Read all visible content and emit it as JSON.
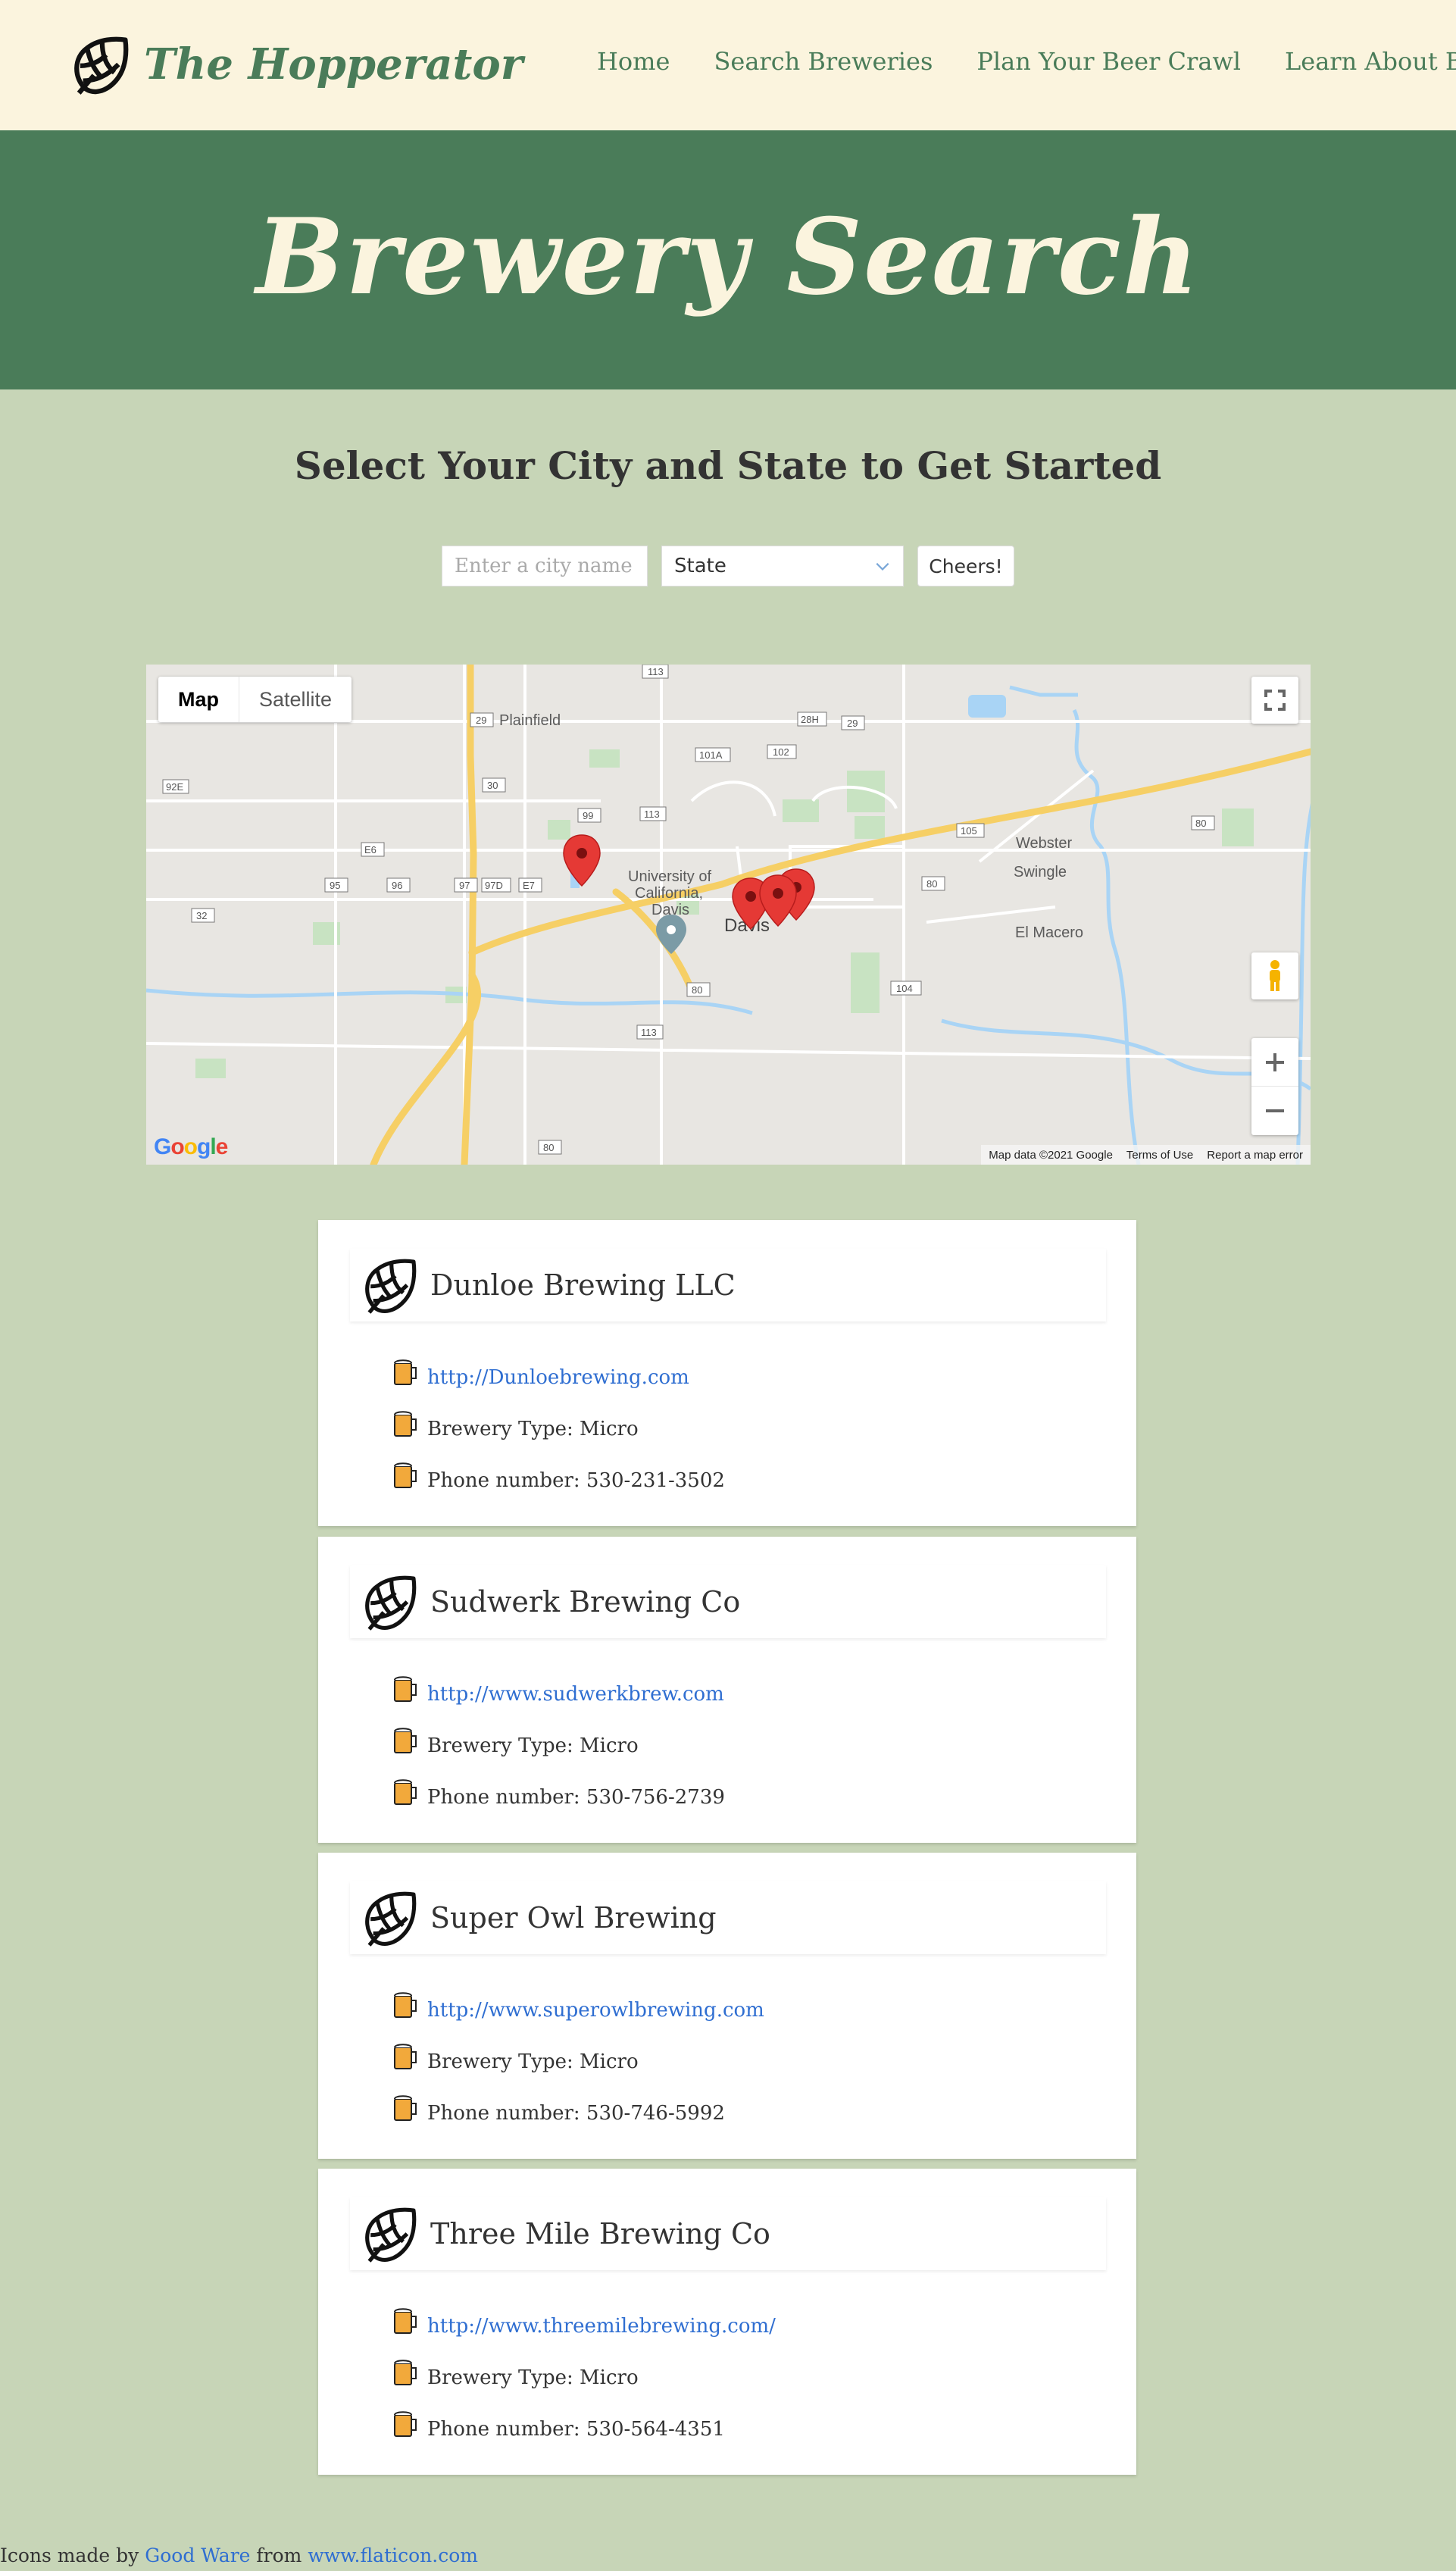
{
  "nav": {
    "brand": "The Hopperator",
    "links": [
      "Home",
      "Search Breweries",
      "Plan Your Beer Crawl",
      "Learn About Beer"
    ]
  },
  "hero": {
    "title": "Brewery Search"
  },
  "search": {
    "heading": "Select Your City and State to Get Started",
    "city_placeholder": "Enter a city name",
    "city_value": "",
    "state_selected": "State",
    "submit_label": "Cheers!"
  },
  "map": {
    "type_map": "Map",
    "type_satellite": "Satellite",
    "labels": {
      "plainfield": "Plainfield",
      "university": "University of",
      "university2": "California,",
      "university3": "Davis",
      "davis": "Davis",
      "el_macero": "El Macero",
      "swingle": "Swingle",
      "webster": "Webster"
    },
    "road_shields": [
      "113",
      "29",
      "28H",
      "29",
      "101A",
      "102",
      "92E",
      "30",
      "99",
      "113",
      "105",
      "E6",
      "95",
      "96",
      "97",
      "97D",
      "E7",
      "32",
      "80",
      "80",
      "104",
      "113",
      "80",
      "80"
    ],
    "logo": "Google",
    "footer": [
      "Map data ©2021 Google",
      "Terms of Use",
      "Report a map error"
    ]
  },
  "breweries": [
    {
      "name": "Dunloe Brewing LLC",
      "url": "http://Dunloebrewing.com",
      "type": "Brewery Type: Micro",
      "phone": "Phone number: 530-231-3502"
    },
    {
      "name": "Sudwerk Brewing Co",
      "url": "http://www.sudwerkbrew.com",
      "type": "Brewery Type: Micro",
      "phone": "Phone number: 530-756-2739"
    },
    {
      "name": "Super Owl Brewing",
      "url": "http://www.superowlbrewing.com",
      "type": "Brewery Type: Micro",
      "phone": "Phone number: 530-746-5992"
    },
    {
      "name": "Three Mile Brewing Co",
      "url": "http://www.threemilebrewing.com/",
      "type": "Brewery Type: Micro",
      "phone": "Phone number: 530-564-4351"
    }
  ],
  "footer": {
    "prefix": "Icons made by",
    "author": "Good Ware",
    "mid": "from",
    "site": "www.flaticon.com"
  },
  "colors": {
    "nav_bg": "#fbf4de",
    "hero_bg": "#4a7c59",
    "page_bg": "#c7d5b7",
    "accent_green": "#4a7c59",
    "link_blue": "#2f6ed1"
  }
}
